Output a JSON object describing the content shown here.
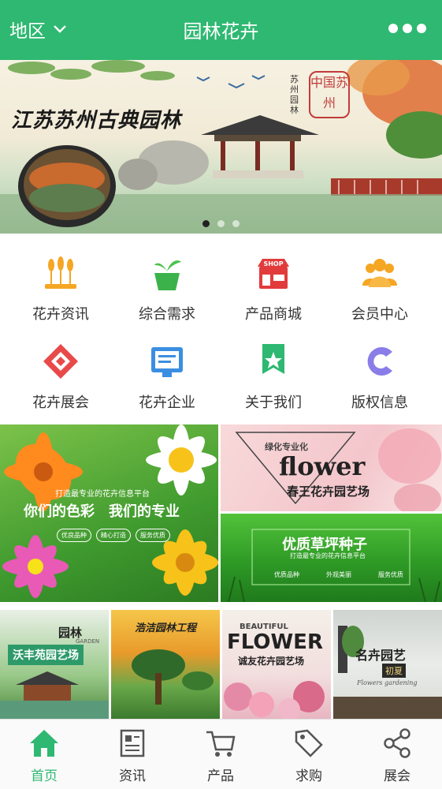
{
  "header": {
    "region": "地区",
    "title": "园林花卉",
    "bg": "#2eb872"
  },
  "banner": {
    "headline": "江苏苏州古典园林",
    "vertical_text": "苏州园林",
    "seal": "中国苏州",
    "slides": 3,
    "active_slide": 0
  },
  "menu": [
    {
      "label": "花卉资讯",
      "icon": "wheat-icon"
    },
    {
      "label": "综合需求",
      "icon": "plant-pot-icon"
    },
    {
      "label": "产品商城",
      "icon": "shop-icon",
      "badge": "SHOP"
    },
    {
      "label": "会员中心",
      "icon": "members-icon"
    },
    {
      "label": "花卉展会",
      "icon": "exhibition-icon"
    },
    {
      "label": "花卉企业",
      "icon": "enterprise-icon"
    },
    {
      "label": "关于我们",
      "icon": "about-star-icon"
    },
    {
      "label": "版权信息",
      "icon": "copyright-c-icon"
    }
  ],
  "promos": {
    "left": {
      "subtitle": "打造最专业的花卉信息平台",
      "slogan_a": "你们的色彩",
      "slogan_b": "我们的专业",
      "tags": [
        "优良品种",
        "精心打造",
        "服务优质"
      ]
    },
    "right_top": {
      "small": "绿化专业化",
      "big": "flower",
      "name": "春王花卉园艺场"
    },
    "right_bottom": {
      "title": "优质草坪种子",
      "subtitle": "打造最专业的花卉信息平台",
      "tags": [
        "优质品种",
        "外观美丽",
        "服务优质"
      ]
    }
  },
  "thumbs": [
    {
      "title": "沃丰苑园艺场",
      "mark": "园林",
      "mark_en": "GARDEN"
    },
    {
      "title": "浩洁园林工程"
    },
    {
      "title": "诚友花卉园艺场",
      "top": "BEAUTIFUL",
      "big": "FLOWER"
    },
    {
      "title": "名卉园艺",
      "sub": "初夏",
      "script": "Flowers gardening"
    }
  ],
  "nav": [
    {
      "label": "首页",
      "icon": "home-icon",
      "active": true
    },
    {
      "label": "资讯",
      "icon": "news-icon",
      "active": false
    },
    {
      "label": "产品",
      "icon": "cart-icon",
      "active": false
    },
    {
      "label": "求购",
      "icon": "tag-icon",
      "active": false
    },
    {
      "label": "展会",
      "icon": "share-icon",
      "active": false
    }
  ]
}
